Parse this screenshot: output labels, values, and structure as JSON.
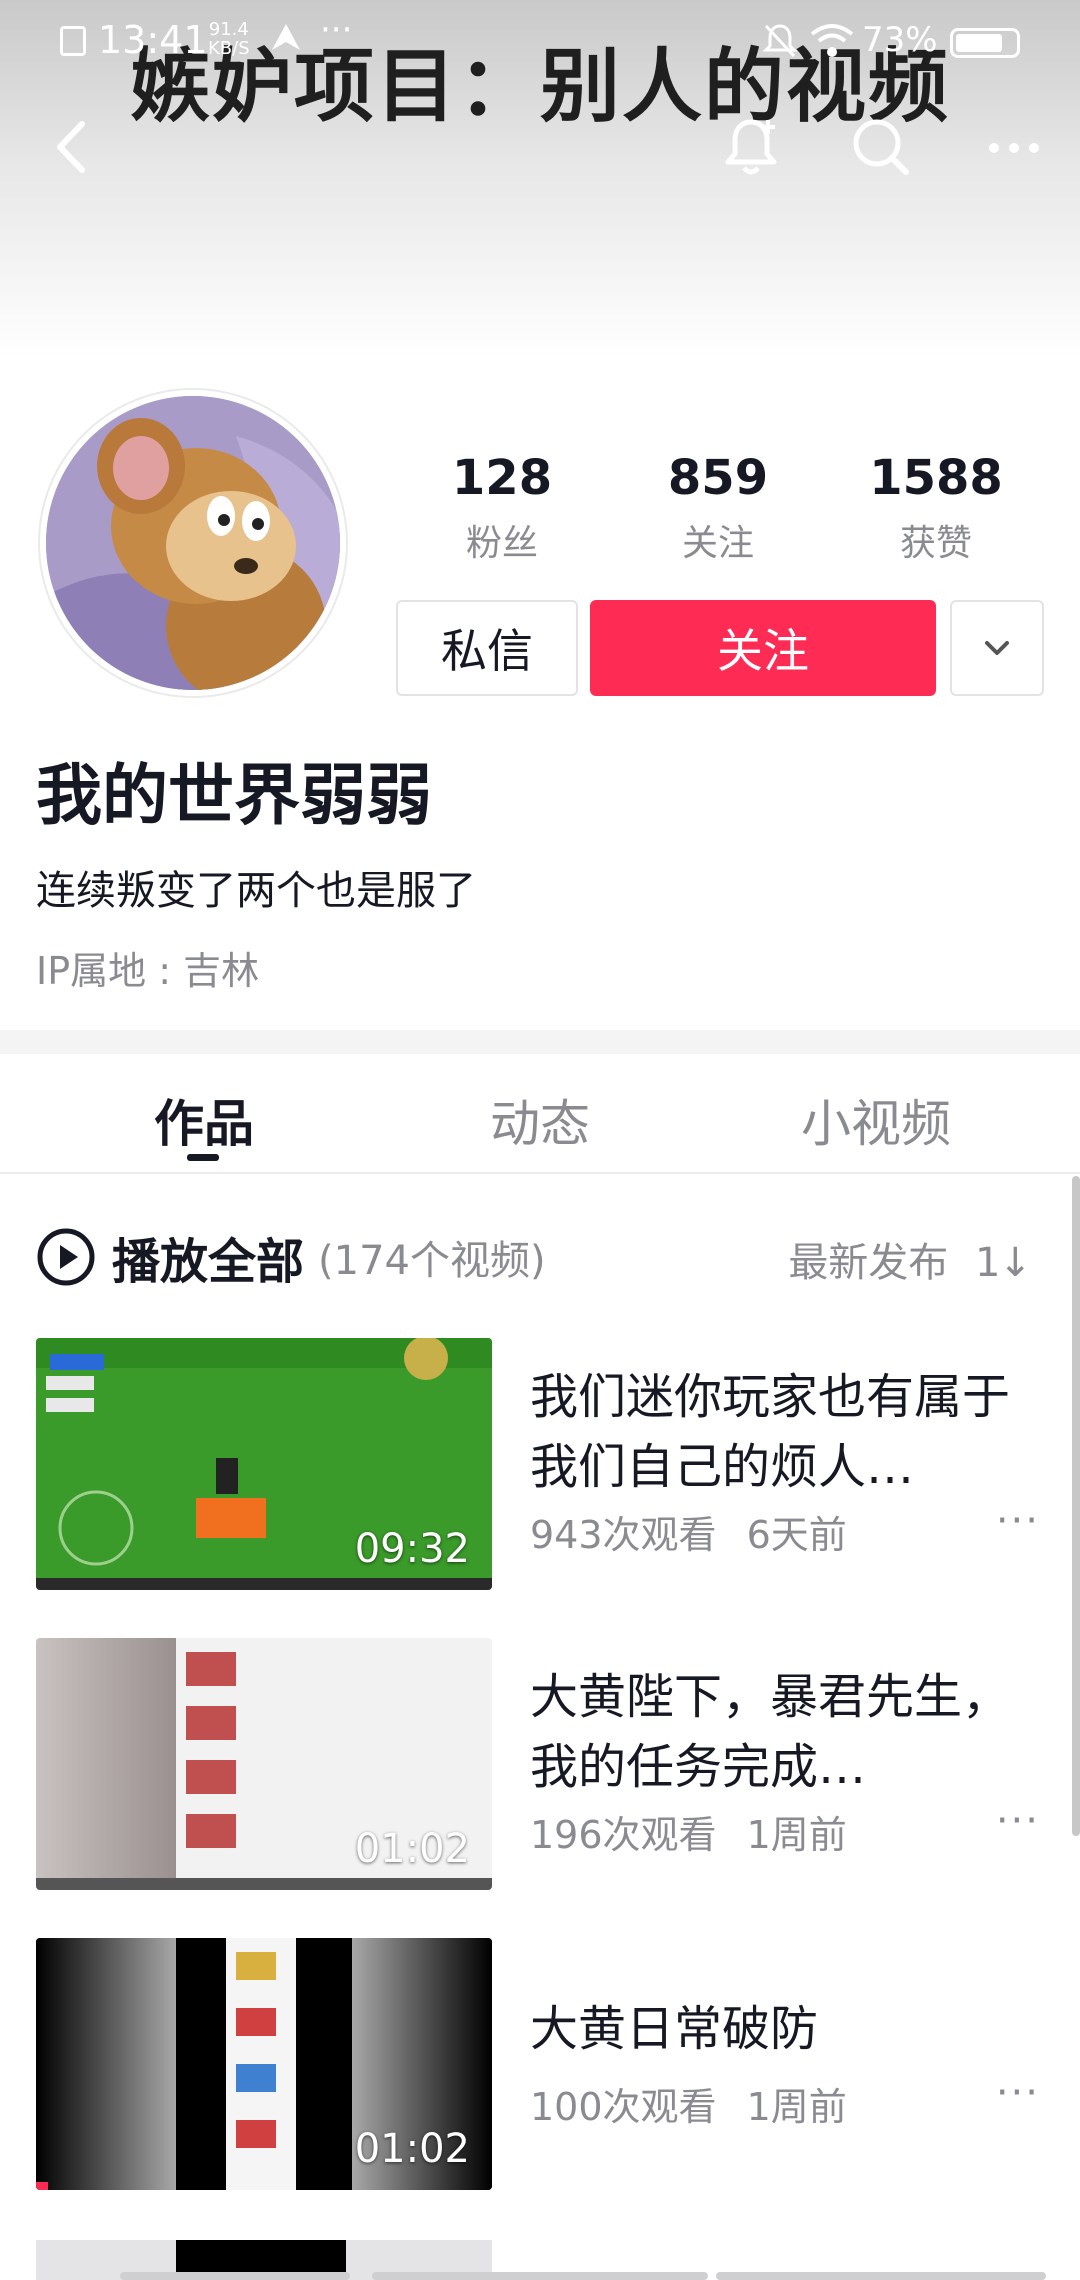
{
  "status_bar": {
    "time": "13:41",
    "net_speed_value": "91.4",
    "net_speed_unit": "KB/S",
    "battery": "73%"
  },
  "cover": {
    "overlay_text": "嫉妒项目：别人的视频"
  },
  "nav": {
    "back_icon": "chevron-left-icon",
    "bell_icon": "bell-add-icon",
    "search_icon": "search-icon",
    "more_icon": "more-horizontal-icon"
  },
  "profile": {
    "stats": [
      {
        "value": "128",
        "label": "粉丝"
      },
      {
        "value": "859",
        "label": "关注"
      },
      {
        "value": "1588",
        "label": "获赞"
      }
    ],
    "message_button": "私信",
    "follow_button": "关注",
    "name": "我的世界弱弱",
    "bio": "连续叛变了两个也是服了",
    "ip_location": "IP属地 : 吉林",
    "accent_color": "#fe2c55"
  },
  "tabs": [
    {
      "label": "作品",
      "active": true
    },
    {
      "label": "动态",
      "active": false
    },
    {
      "label": "小视频",
      "active": false
    }
  ],
  "list_header": {
    "play_all": "播放全部",
    "count": "(174个视频)",
    "sort": "最新发布",
    "sort_icon": "sort-icon"
  },
  "videos": [
    {
      "title": "我们迷你玩家也有属于我们自己的烦人…",
      "views": "943次观看",
      "time": "6天前",
      "duration": "09:32"
    },
    {
      "title": "大黄陛下，暴君先生， 我的任务完成…",
      "views": "196次观看",
      "time": "1周前",
      "duration": "01:02"
    },
    {
      "title": "大黄日常破防",
      "views": "100次观看",
      "time": "1周前",
      "duration": "01:02"
    }
  ]
}
